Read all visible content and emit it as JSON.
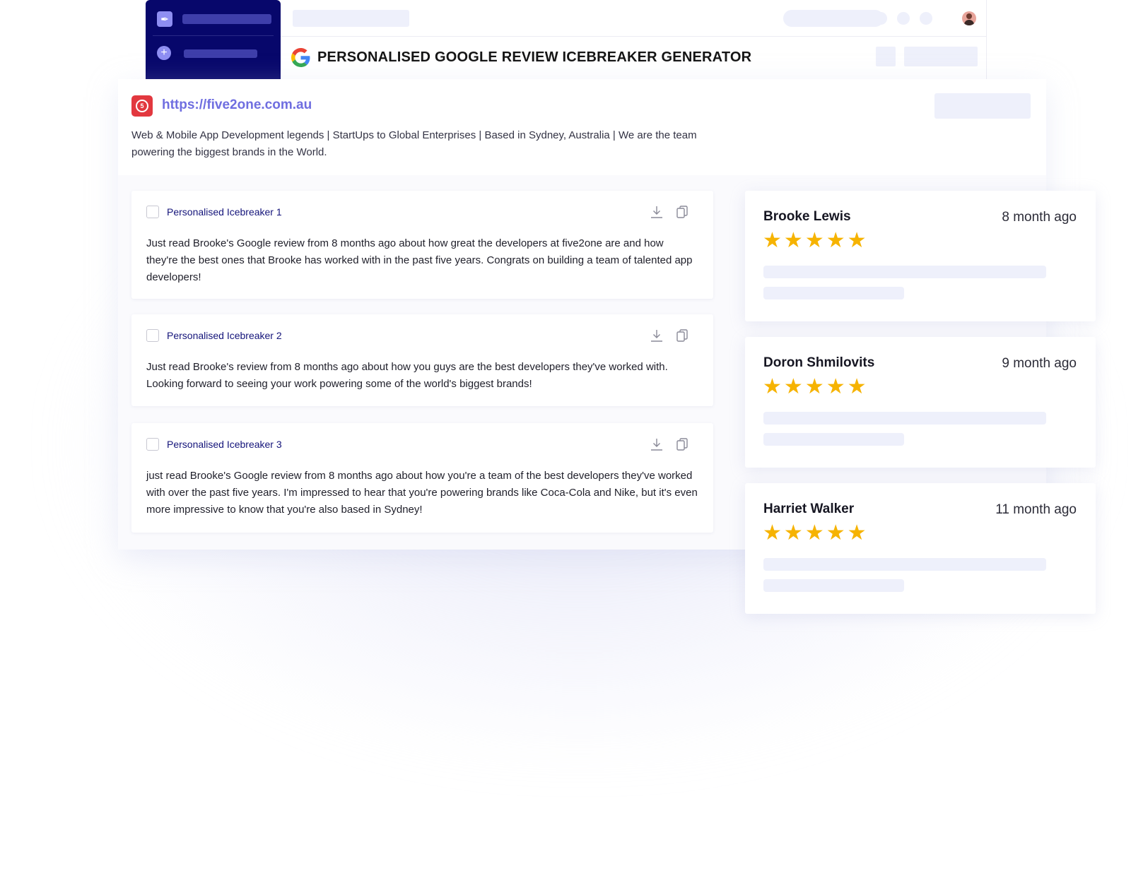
{
  "header": {
    "title": "PERSONALISED GOOGLE REVIEW ICEBREAKER GENERATOR"
  },
  "company": {
    "url": "https://five2one.com.au",
    "description": "Web & Mobile App Development legends | StartUps to Global Enterprises | Based in Sydney, Australia | We are the team powering the biggest brands in the World."
  },
  "icebreakers": [
    {
      "label": "Personalised Icebreaker 1",
      "text": "Just read Brooke's Google review from 8 months ago about how great the developers at five2one are and how they're the best ones that Brooke has worked with in the past five years. Congrats on building a team of talented app developers!"
    },
    {
      "label": "Personalised Icebreaker 2",
      "text": "Just read Brooke's review from 8 months ago about how you guys are the best developers they've worked with. Looking forward to seeing your work powering some of the world's biggest brands!"
    },
    {
      "label": "Personalised Icebreaker 3",
      "text": "just read Brooke's Google review from 8 months ago about how you're a team of the best developers they've worked with over the past five years. I'm impressed to hear that you're powering brands like Coca-Cola and Nike, but it's even more impressive to know that you're also based in Sydney!"
    }
  ],
  "reviews": [
    {
      "name": "Brooke Lewis",
      "time": "8 month ago",
      "stars": 5
    },
    {
      "name": "Doron Shmilovits",
      "time": "9 month ago",
      "stars": 5
    },
    {
      "name": "Harriet Walker",
      "time": "11 month ago",
      "stars": 5
    }
  ],
  "colors": {
    "sidebar": "#07076b",
    "accent": "#6f6ee0",
    "star": "#f6b301",
    "placeholder": "#eef0fb"
  },
  "icons": [
    "feather-icon",
    "plus-icon",
    "google-icon",
    "company-logo-icon",
    "download-icon",
    "copy-icon",
    "star-icon",
    "avatar"
  ]
}
